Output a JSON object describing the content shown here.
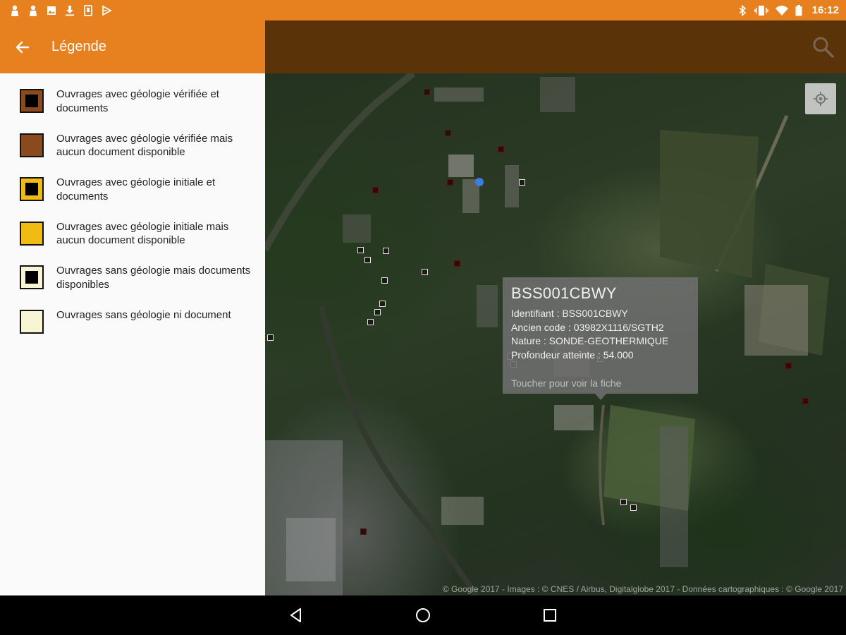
{
  "status_bar": {
    "left_icons": [
      "person-icon",
      "person-icon",
      "image-icon",
      "download-icon",
      "phone-icon",
      "play-store-icon"
    ],
    "right_icons": [
      "bluetooth-icon",
      "vibrate-icon",
      "wifi-icon",
      "battery-icon"
    ],
    "time": "16:12"
  },
  "colors": {
    "status_bar": "#e7801f",
    "drawer_header": "#e7801f",
    "map_toolbar": "#5b3308",
    "drawer_background": "#fafafa"
  },
  "drawer": {
    "title": "Légende",
    "back_icon": "arrow-back-icon",
    "legend": [
      {
        "label": "Ouvrages avec géologie vérifiée et documents",
        "fill": "#8b4a1e",
        "inner": "#000000"
      },
      {
        "label": "Ouvrages avec géologie vérifiée mais aucun document disponible",
        "fill": "#8b4a1e",
        "inner": ""
      },
      {
        "label": "Ouvrages avec géologie initiale et documents",
        "fill": "#f0bc14",
        "inner": "#000000"
      },
      {
        "label": "Ouvrages avec géologie initiale mais aucun document disponible",
        "fill": "#f0bc14",
        "inner": ""
      },
      {
        "label": "Ouvrages sans géologie mais documents disponibles",
        "fill": "#f7f5d4",
        "inner": "#000000"
      },
      {
        "label": "Ouvrages sans géologie ni document",
        "fill": "#f7f5d4",
        "inner": ""
      }
    ]
  },
  "map": {
    "search_icon": "search-icon",
    "locate_icon": "my-location-icon",
    "info_window": {
      "title": "BSS001CBWY",
      "identifiant": "Identifiant : BSS001CBWY",
      "ancien_code": "Ancien code : 03982X1116/SGTH2",
      "nature": "Nature : SONDE-GEOTHERMIQUE",
      "profondeur": "Profondeur atteinte : 54.000",
      "hint": "Toucher pour voir la fiche"
    },
    "attribution": "© Google 2017 - Images : © CNES / Airbus, Digitalglobe 2017 - Données cartographiques : © Google 2017"
  },
  "nav_bar": {
    "back_icon": "nav-back-icon",
    "home_icon": "nav-home-icon",
    "recents_icon": "nav-recents-icon"
  }
}
